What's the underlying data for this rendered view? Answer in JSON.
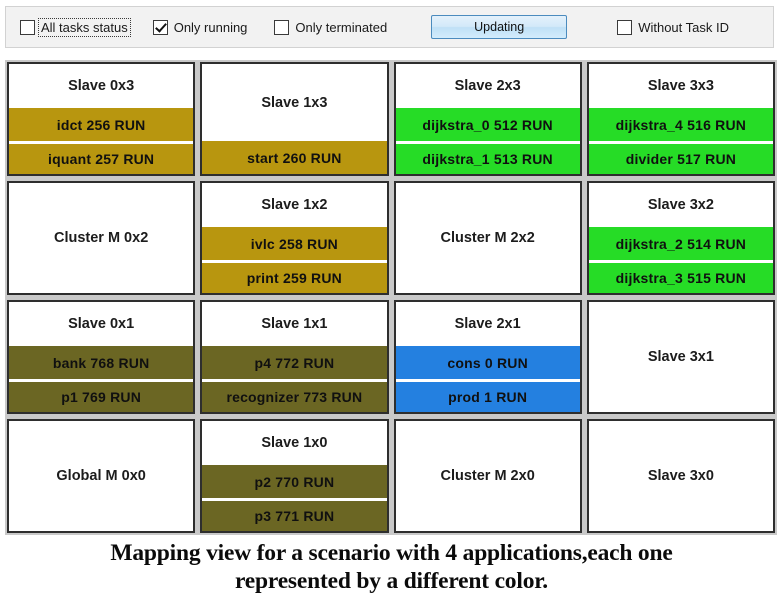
{
  "toolbar": {
    "checkboxes": [
      {
        "label": "All tasks status",
        "checked": false,
        "focused": true
      },
      {
        "label": "Only running",
        "checked": true,
        "focused": false
      },
      {
        "label": "Only terminated",
        "checked": false,
        "focused": false
      }
    ],
    "update_button_label": "Updating",
    "without_task_id": {
      "label": "Without Task ID",
      "checked": false,
      "focused": false
    }
  },
  "colors": {
    "background": "#c9c9c9",
    "cell_border": "#2e2e2e",
    "cell_background": "#ffffff",
    "app_gold": "#b8960f",
    "app_olive": "#6b6623",
    "app_green": "#26dc26",
    "app_blue": "#2480e0",
    "button_accent": "#4b8bbe"
  },
  "grid": {
    "columns": 4,
    "rows": 4,
    "cells": [
      {
        "title": "Slave 0x3",
        "tasks": [
          {
            "name": "idct",
            "id": "256",
            "state": "RUN",
            "text": "idct  256  RUN",
            "color": "#b8960f"
          },
          {
            "name": "iquant",
            "id": "257",
            "state": "RUN",
            "text": "iquant  257  RUN",
            "color": "#b8960f"
          }
        ]
      },
      {
        "title": "Slave 1x3",
        "tasks": [
          {
            "name": "start",
            "id": "260",
            "state": "RUN",
            "text": "start  260  RUN",
            "color": "#b8960f"
          }
        ]
      },
      {
        "title": "Slave 2x3",
        "tasks": [
          {
            "name": "dijkstra_0",
            "id": "512",
            "state": "RUN",
            "text": "dijkstra_0  512  RUN",
            "color": "#26dc26"
          },
          {
            "name": "dijkstra_1",
            "id": "513",
            "state": "RUN",
            "text": "dijkstra_1  513  RUN",
            "color": "#26dc26"
          }
        ]
      },
      {
        "title": "Slave 3x3",
        "tasks": [
          {
            "name": "dijkstra_4",
            "id": "516",
            "state": "RUN",
            "text": "dijkstra_4  516  RUN",
            "color": "#26dc26"
          },
          {
            "name": "divider",
            "id": "517",
            "state": "RUN",
            "text": "divider  517  RUN",
            "color": "#26dc26"
          }
        ]
      },
      {
        "title": "Cluster M 0x2",
        "tasks": []
      },
      {
        "title": "Slave 1x2",
        "tasks": [
          {
            "name": "ivlc",
            "id": "258",
            "state": "RUN",
            "text": "ivlc  258  RUN",
            "color": "#b8960f"
          },
          {
            "name": "print",
            "id": "259",
            "state": "RUN",
            "text": "print  259  RUN",
            "color": "#b8960f"
          }
        ]
      },
      {
        "title": "Cluster M 2x2",
        "tasks": []
      },
      {
        "title": "Slave 3x2",
        "tasks": [
          {
            "name": "dijkstra_2",
            "id": "514",
            "state": "RUN",
            "text": "dijkstra_2  514  RUN",
            "color": "#26dc26"
          },
          {
            "name": "dijkstra_3",
            "id": "515",
            "state": "RUN",
            "text": "dijkstra_3  515  RUN",
            "color": "#26dc26"
          }
        ]
      },
      {
        "title": "Slave 0x1",
        "tasks": [
          {
            "name": "bank",
            "id": "768",
            "state": "RUN",
            "text": "bank  768  RUN",
            "color": "#6b6623"
          },
          {
            "name": "p1",
            "id": "769",
            "state": "RUN",
            "text": "p1  769  RUN",
            "color": "#6b6623"
          }
        ]
      },
      {
        "title": "Slave 1x1",
        "tasks": [
          {
            "name": "p4",
            "id": "772",
            "state": "RUN",
            "text": "p4  772  RUN",
            "color": "#6b6623"
          },
          {
            "name": "recognizer",
            "id": "773",
            "state": "RUN",
            "text": "recognizer  773  RUN",
            "color": "#6b6623"
          }
        ]
      },
      {
        "title": "Slave 2x1",
        "tasks": [
          {
            "name": "cons",
            "id": "0",
            "state": "RUN",
            "text": "cons  0  RUN",
            "color": "#2480e0"
          },
          {
            "name": "prod",
            "id": "1",
            "state": "RUN",
            "text": "prod  1  RUN",
            "color": "#2480e0"
          }
        ]
      },
      {
        "title": "Slave 3x1",
        "tasks": []
      },
      {
        "title": "Global M 0x0",
        "tasks": []
      },
      {
        "title": "Slave 1x0",
        "tasks": [
          {
            "name": "p2",
            "id": "770",
            "state": "RUN",
            "text": "p2  770  RUN",
            "color": "#6b6623"
          },
          {
            "name": "p3",
            "id": "771",
            "state": "RUN",
            "text": "p3  771  RUN",
            "color": "#6b6623"
          }
        ]
      },
      {
        "title": "Cluster M 2x0",
        "tasks": []
      },
      {
        "title": "Slave 3x0",
        "tasks": []
      }
    ]
  },
  "caption": {
    "line1": "Mapping view for a scenario with 4 applications,each one",
    "line2": "represented by a different color."
  }
}
